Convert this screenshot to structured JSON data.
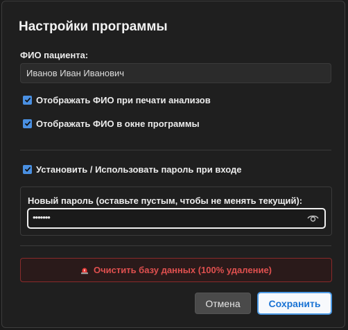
{
  "dialog": {
    "title": "Настройки программы"
  },
  "patient": {
    "label": "ФИО пациента:",
    "value": "Иванов Иван Иванович"
  },
  "options": {
    "show_in_print": {
      "label": "Отображать ФИО при печати анализов",
      "checked": true
    },
    "show_in_window": {
      "label": "Отображать ФИО в окне программы",
      "checked": true
    },
    "use_password": {
      "label": "Установить / Использовать пароль при входе",
      "checked": true
    }
  },
  "password": {
    "label": "Новый пароль (оставьте пустым, чтобы не менять текущий):",
    "masked_value": "•••••••"
  },
  "actions": {
    "clear_db_label": "Очистить базу данных (100% удаление)",
    "cancel_label": "Отмена",
    "save_label": "Сохранить"
  },
  "colors": {
    "accent": "#4a90e2",
    "danger": "#e0504f",
    "background": "#1f1f1f"
  }
}
